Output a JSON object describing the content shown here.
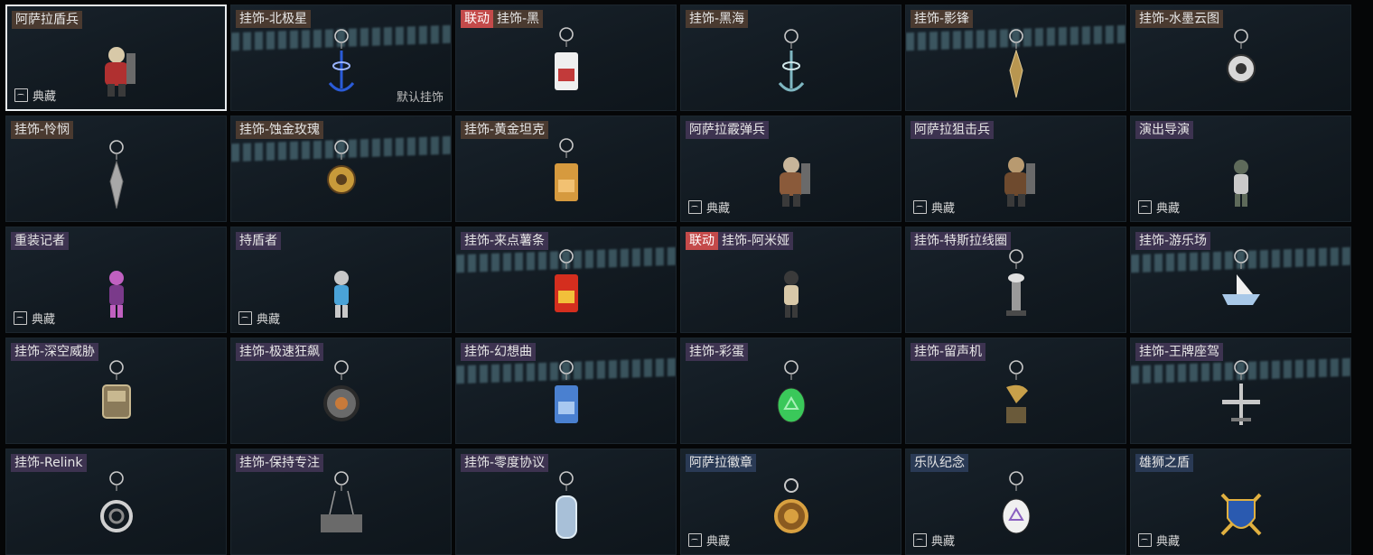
{
  "default_label": "默认挂饰",
  "collection_label": "典藏",
  "cards": [
    {
      "tag": "",
      "name": "阿萨拉盾兵",
      "tone": "brown",
      "collection": true,
      "default": false,
      "selected": true,
      "art": "character",
      "colors": [
        "#b03030",
        "#d8c9a8"
      ]
    },
    {
      "tag": "",
      "name": "挂饰-北极星",
      "tone": "brown",
      "collection": false,
      "default": true,
      "selected": false,
      "art": "charm",
      "colors": [
        "#2a5bd8",
        "#9ab4ff"
      ],
      "streak": true
    },
    {
      "tag": "联动",
      "name": "挂饰-黑",
      "tone": "brown",
      "collection": false,
      "default": false,
      "selected": false,
      "art": "card",
      "colors": [
        "#efefef",
        "#c23a3a"
      ]
    },
    {
      "tag": "",
      "name": "挂饰-黑海",
      "tone": "brown",
      "collection": false,
      "default": false,
      "selected": false,
      "art": "charm",
      "colors": [
        "#7fb7c2",
        "#d0e7ea"
      ]
    },
    {
      "tag": "",
      "name": "挂饰-影锋",
      "tone": "brown",
      "collection": false,
      "default": false,
      "selected": false,
      "art": "blade",
      "colors": [
        "#b89650",
        "#e0c890"
      ],
      "streak": true
    },
    {
      "tag": "",
      "name": "挂饰-水墨云图",
      "tone": "brown",
      "collection": false,
      "default": false,
      "selected": false,
      "art": "round",
      "colors": [
        "#d8d8d8",
        "#333333"
      ]
    },
    {
      "tag": "",
      "name": "挂饰-怜悯",
      "tone": "brown",
      "collection": false,
      "default": false,
      "selected": false,
      "art": "blade",
      "colors": [
        "#a8a8a8",
        "#6d6d6d"
      ]
    },
    {
      "tag": "",
      "name": "挂饰-蚀金玫瑰",
      "tone": "brown",
      "collection": false,
      "default": false,
      "selected": false,
      "art": "round",
      "colors": [
        "#c89a3a",
        "#5a3e1c"
      ],
      "streak": true
    },
    {
      "tag": "",
      "name": "挂饰-黄金坦克",
      "tone": "brown",
      "collection": false,
      "default": false,
      "selected": false,
      "art": "card",
      "colors": [
        "#d69a3e",
        "#f2c172"
      ]
    },
    {
      "tag": "",
      "name": "阿萨拉霰弹兵",
      "tone": "purple",
      "collection": true,
      "default": false,
      "selected": false,
      "art": "character",
      "colors": [
        "#8a5a3a",
        "#c7b59a"
      ]
    },
    {
      "tag": "",
      "name": "阿萨拉狙击兵",
      "tone": "purple",
      "collection": true,
      "default": false,
      "selected": false,
      "art": "character",
      "colors": [
        "#6e4a2e",
        "#b89a70"
      ]
    },
    {
      "tag": "",
      "name": "演出导演",
      "tone": "purple",
      "collection": true,
      "default": false,
      "selected": false,
      "art": "figure",
      "colors": [
        "#5e6a5a",
        "#c9c9c9"
      ]
    },
    {
      "tag": "",
      "name": "重装记者",
      "tone": "purple",
      "collection": true,
      "default": false,
      "selected": false,
      "art": "figure",
      "colors": [
        "#c060c0",
        "#7a3a8a"
      ]
    },
    {
      "tag": "",
      "name": "持盾者",
      "tone": "purple",
      "collection": true,
      "default": false,
      "selected": false,
      "art": "figure",
      "colors": [
        "#c8c8c8",
        "#4aa3d8"
      ]
    },
    {
      "tag": "",
      "name": "挂饰-来点薯条",
      "tone": "purple",
      "collection": false,
      "default": false,
      "selected": false,
      "art": "card",
      "colors": [
        "#d42e1e",
        "#f2c03a"
      ],
      "streak": true
    },
    {
      "tag": "联动",
      "name": "挂饰-阿米娅",
      "tone": "purple",
      "collection": false,
      "default": false,
      "selected": false,
      "art": "figure",
      "colors": [
        "#3a3a3a",
        "#d8c8a8"
      ]
    },
    {
      "tag": "",
      "name": "挂饰-特斯拉线圈",
      "tone": "purple",
      "collection": false,
      "default": false,
      "selected": false,
      "art": "tower",
      "colors": [
        "#9a9a9a",
        "#e0e0e0"
      ]
    },
    {
      "tag": "",
      "name": "挂饰-游乐场",
      "tone": "purple",
      "collection": false,
      "default": false,
      "selected": false,
      "art": "ship",
      "colors": [
        "#a8c8e8",
        "#f0f0f0"
      ],
      "streak": true
    },
    {
      "tag": "",
      "name": "挂饰-深空威胁",
      "tone": "purple",
      "collection": false,
      "default": false,
      "selected": false,
      "art": "box",
      "colors": [
        "#8a7a5a",
        "#c8b890"
      ]
    },
    {
      "tag": "",
      "name": "挂饰-极速狂飙",
      "tone": "purple",
      "collection": false,
      "default": false,
      "selected": false,
      "art": "wheel",
      "colors": [
        "#6a6a6a",
        "#c87a3a"
      ]
    },
    {
      "tag": "",
      "name": "挂饰-幻想曲",
      "tone": "purple",
      "collection": false,
      "default": false,
      "selected": false,
      "art": "card",
      "colors": [
        "#4a80d0",
        "#a8c8f0"
      ],
      "streak": true
    },
    {
      "tag": "",
      "name": "挂饰-彩蛋",
      "tone": "purple",
      "collection": false,
      "default": false,
      "selected": false,
      "art": "egg",
      "colors": [
        "#3ac85a",
        "#a8f0b8"
      ]
    },
    {
      "tag": "",
      "name": "挂饰-留声机",
      "tone": "purple",
      "collection": false,
      "default": false,
      "selected": false,
      "art": "horn",
      "colors": [
        "#c8a04a",
        "#6a5a3a"
      ]
    },
    {
      "tag": "",
      "name": "挂饰-王牌座驾",
      "tone": "purple",
      "collection": false,
      "default": false,
      "selected": false,
      "art": "plane",
      "colors": [
        "#c8c8c8",
        "#7a7a7a"
      ],
      "streak": true
    },
    {
      "tag": "",
      "name": "挂饰-Relink",
      "tone": "purple",
      "collection": false,
      "default": false,
      "selected": false,
      "art": "knot",
      "colors": [
        "#d0d0d0",
        "#8a8a8a"
      ]
    },
    {
      "tag": "",
      "name": "挂饰-保持专注",
      "tone": "purple",
      "collection": false,
      "default": false,
      "selected": false,
      "art": "plate",
      "colors": [
        "#6a6a6a",
        "#9a9a9a"
      ]
    },
    {
      "tag": "",
      "name": "挂饰-零度协议",
      "tone": "purple",
      "collection": false,
      "default": false,
      "selected": false,
      "art": "tag",
      "colors": [
        "#a8c0d8",
        "#e0ecf4"
      ]
    },
    {
      "tag": "",
      "name": "阿萨拉徽章",
      "tone": "navy",
      "collection": true,
      "default": false,
      "selected": false,
      "art": "medal",
      "colors": [
        "#d8a040",
        "#8a5a20"
      ]
    },
    {
      "tag": "",
      "name": "乐队纪念",
      "tone": "navy",
      "collection": true,
      "default": false,
      "selected": false,
      "art": "egg",
      "colors": [
        "#f0f0f0",
        "#8a60c0"
      ]
    },
    {
      "tag": "",
      "name": "雄狮之盾",
      "tone": "navy",
      "collection": true,
      "default": false,
      "selected": false,
      "art": "shield",
      "colors": [
        "#2a5ab0",
        "#e0b040"
      ]
    }
  ]
}
